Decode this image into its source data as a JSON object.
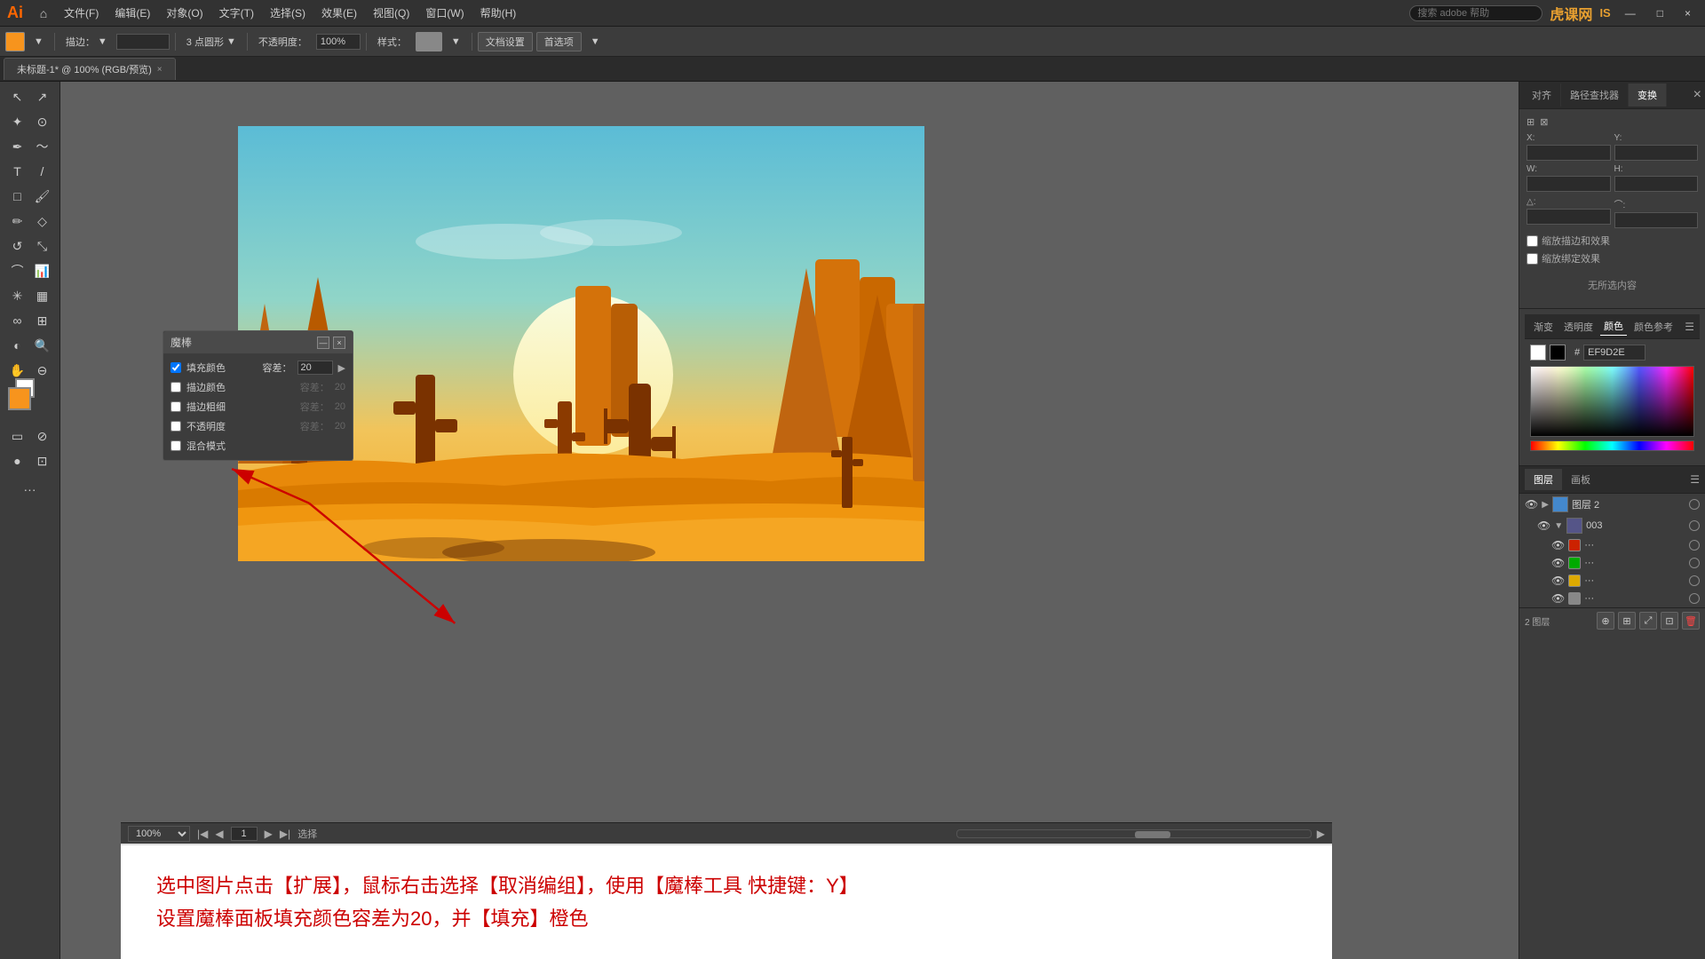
{
  "app": {
    "logo": "Ai",
    "watermark": "虎课网",
    "watermark_sub": "IS"
  },
  "menu": {
    "items": [
      "文件(F)",
      "编辑(E)",
      "对象(O)",
      "文字(T)",
      "选择(S)",
      "效果(E)",
      "视图(Q)",
      "窗口(W)",
      "帮助(H)"
    ]
  },
  "toolbar": {
    "stroke_label": "描边：",
    "point_label": "3 点圆形",
    "opacity_label": "不透明度：",
    "opacity_value": "100%",
    "style_label": "样式：",
    "doc_settings": "文档设置",
    "preferences": "首选项"
  },
  "tab": {
    "title": "未标题-1* @ 100% (RGB/预览)",
    "close": "×"
  },
  "magic_wand_panel": {
    "title": "魔棒",
    "fill_color": "填充颜色",
    "stroke_color": "描边颜色",
    "stroke_width": "描边粗细",
    "opacity": "不透明度",
    "blend_mode": "混合模式",
    "tolerance_label": "容差：",
    "tolerance_value": "20",
    "min_btn": "—",
    "close_btn": "×"
  },
  "instructions": {
    "line1": "选中图片点击【扩展】，鼠标右击选择【取消编组】，使用【魔棒工具 快捷键：Y】",
    "line2": "设置魔棒面板填充颜色容差为20，并【填充】橙色"
  },
  "right_panel": {
    "tabs": [
      "对齐",
      "路径查找器",
      "变换"
    ],
    "active_tab": "变换",
    "no_selection": "无所选内容",
    "scale_strokes_label": "缩放描边和效果",
    "align_label": "缩放绑定效果",
    "transform_icons": [
      "↔",
      "↕",
      "↗",
      "⊡"
    ]
  },
  "color_panel": {
    "tabs": [
      "渐变",
      "透明度",
      "颜色",
      "颜色参考"
    ],
    "active_tab": "颜色",
    "hex_label": "#",
    "hex_value": "EF9D2E"
  },
  "layers_panel": {
    "tabs": [
      "图层",
      "画板"
    ],
    "active_tab": "图层",
    "items": [
      {
        "name": "图层 2",
        "visible": true,
        "expanded": true,
        "indent": 0
      },
      {
        "name": "003",
        "visible": true,
        "expanded": true,
        "indent": 1
      },
      {
        "name": "...",
        "visible": true,
        "color": "#cc2200",
        "indent": 2
      },
      {
        "name": "...",
        "visible": true,
        "color": "#00aa00",
        "indent": 2
      },
      {
        "name": "...",
        "visible": true,
        "color": "#ddaa00",
        "indent": 2
      },
      {
        "name": "...",
        "visible": true,
        "color": "#888888",
        "indent": 2
      }
    ],
    "footer_label": "2 图层",
    "toolbar_btns": [
      "⊕",
      "⊞",
      "🗑"
    ]
  },
  "status_bar": {
    "zoom": "100%",
    "page": "1",
    "mode": "选择"
  }
}
